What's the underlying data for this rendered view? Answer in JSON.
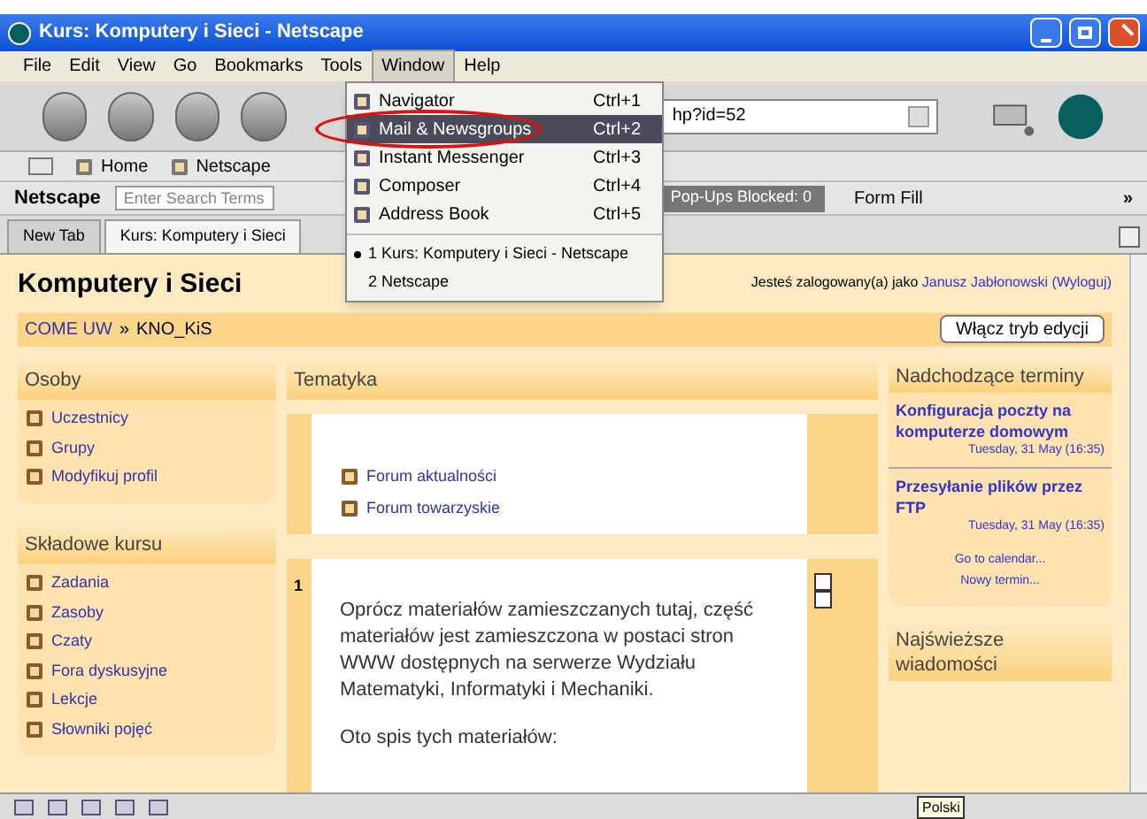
{
  "window": {
    "title": "Kurs: Komputery i Sieci - Netscape"
  },
  "menu_bar": [
    {
      "label": "File",
      "selected": false
    },
    {
      "label": "Edit",
      "selected": false
    },
    {
      "label": "View",
      "selected": false
    },
    {
      "label": "Go",
      "selected": false
    },
    {
      "label": "Bookmarks",
      "selected": false
    },
    {
      "label": "Tools",
      "selected": false
    },
    {
      "label": "Window",
      "selected": true
    },
    {
      "label": "Help",
      "selected": false
    }
  ],
  "window_menu": [
    {
      "kind": "item",
      "label": "Navigator",
      "shortcut": "Ctrl+1",
      "selected": false,
      "circled": false
    },
    {
      "kind": "item",
      "label": "Mail & Newsgroups",
      "shortcut": "Ctrl+2",
      "selected": true,
      "circled": true
    },
    {
      "kind": "item",
      "label": "Instant Messenger",
      "shortcut": "Ctrl+3",
      "selected": false,
      "circled": false
    },
    {
      "kind": "item",
      "label": "Composer",
      "shortcut": "Ctrl+4",
      "selected": false,
      "circled": false
    },
    {
      "kind": "item",
      "label": "Address Book",
      "shortcut": "Ctrl+5",
      "selected": false,
      "circled": false
    },
    {
      "kind": "separator"
    },
    {
      "kind": "window",
      "label": "1 Kurs: Komputery i Sieci - Netscape",
      "checked": true
    },
    {
      "kind": "window",
      "label": "2 Netscape",
      "checked": false
    }
  ],
  "address": {
    "value": "hp?id=52"
  },
  "personal_bar": [
    {
      "label": "Home"
    },
    {
      "label": "Netscape"
    }
  ],
  "search_bar": {
    "brand": "Netscape",
    "placeholder": "Enter Search Terms",
    "popups": "Pop-Ups Blocked: 0",
    "form_fill": "Form Fill",
    "more": "»"
  },
  "tabs": [
    {
      "label": "New Tab",
      "selected": false
    },
    {
      "label": "Kurs: Komputery i Sieci",
      "selected": true
    }
  ],
  "page": {
    "title": "Komputery i Sieci",
    "login_prefix": "Jesteś zalogowany(a) jako",
    "user": "Janusz Jabłonowski",
    "logout": "(Wyloguj)",
    "breadcrumb": [
      {
        "label": "COME UW",
        "link": true
      },
      {
        "label": "»",
        "link": false
      },
      {
        "label": "KNO_KiS",
        "link": false
      }
    ],
    "edit_button": "Włącz tryb edycji",
    "left_blocks": [
      {
        "title": "Osoby",
        "items": [
          "Uczestnicy",
          "Grupy",
          "Modyfikuj profil"
        ]
      },
      {
        "title": "Składowe kursu",
        "items": [
          "Zadania",
          "Zasoby",
          "Czaty",
          "Fora dyskusyjne",
          "Lekcje",
          "Słowniki pojęć"
        ]
      }
    ],
    "center": {
      "title": "Tematyka",
      "section_0": [
        "Forum aktualności",
        "Forum towarzyskie"
      ],
      "section_1": {
        "number": "1",
        "paragraph": "Oprócz materiałów zamieszczanych tutaj, część materiałów jest zamieszczona w postaci stron WWW dostępnych na serwerze Wydziału Matematyki, Informatyki i Mechaniki.",
        "list_intro": "Oto spis tych materiałów:"
      }
    },
    "right": {
      "title": "Nadchodzące terminy",
      "events": [
        {
          "title": "Konfiguracja poczty na komputerze domowym",
          "date": "Tuesday, 31 May (16:35)"
        },
        {
          "title": "Przesyłanie plików przez FTP",
          "date": "Tuesday, 31 May (16:35)"
        }
      ],
      "links": [
        "Go to calendar...",
        "Nowy termin..."
      ],
      "news_title": "Najświeższe wiadomości"
    }
  },
  "status_bar": {
    "tooltip": "Polski"
  }
}
